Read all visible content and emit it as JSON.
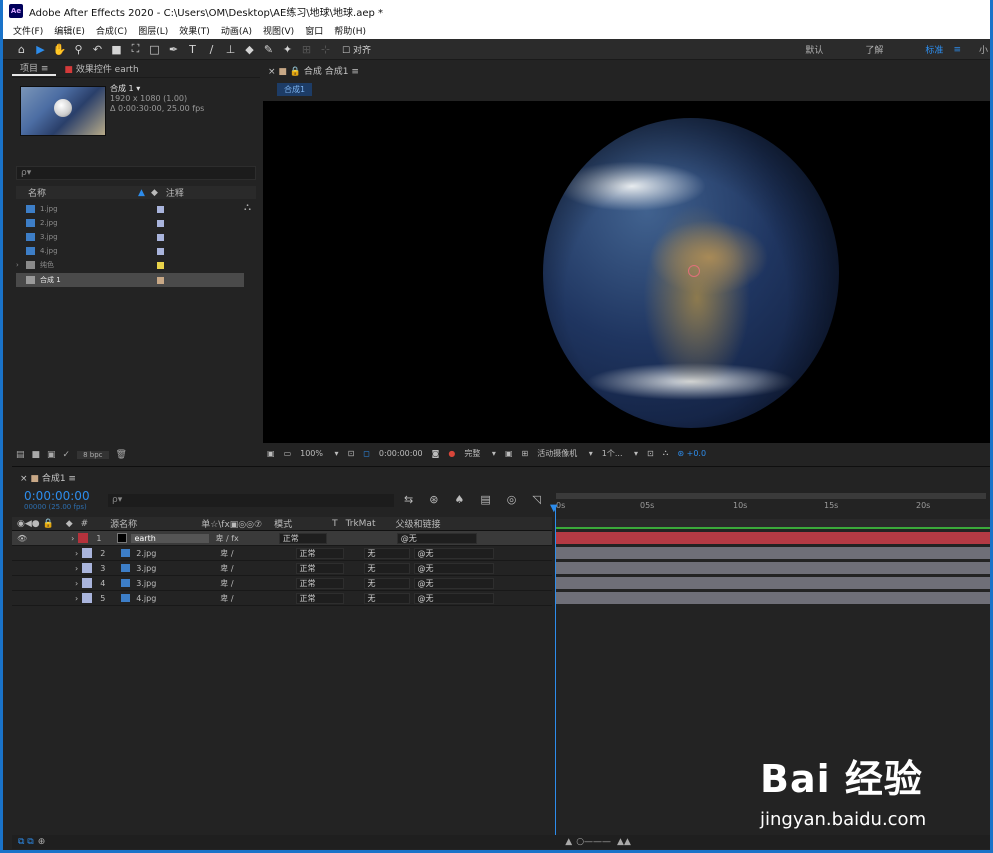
{
  "window": {
    "title": "Adobe After Effects 2020 - C:\\Users\\OM\\Desktop\\AE练习\\地球\\地球.aep *",
    "logo": "Ae"
  },
  "menu": [
    "文件(F)",
    "编辑(E)",
    "合成(C)",
    "图层(L)",
    "效果(T)",
    "动画(A)",
    "视图(V)",
    "窗口",
    "帮助(H)"
  ],
  "toolbar": {
    "tools": [
      "home-icon",
      "selection-icon",
      "hand-icon",
      "zoom-icon",
      "rotate-icon",
      "camera-icon",
      "pan-behind-icon",
      "rectangle-icon",
      "pen-icon",
      "type-icon",
      "brush-icon",
      "clone-stamp-icon",
      "eraser-icon",
      "roto-brush-icon",
      "puppet-pin-icon"
    ],
    "align_label": "对齐",
    "workspaces": [
      "默认",
      "了解",
      "标准",
      "≡",
      "小"
    ]
  },
  "project": {
    "tab_project": "项目",
    "tab_effects": "效果控件 earth",
    "comp_name": "合成 1",
    "comp_info1": "1920 x 1080 (1.00)",
    "comp_info2": "Δ 0:00:30:00, 25.00 fps",
    "search_placeholder": "ρ▾",
    "col_name": "名称",
    "col_notes": "注释",
    "items": [
      {
        "name": "1.jpg",
        "type": "image",
        "label_color": "#a9b4dc"
      },
      {
        "name": "2.jpg",
        "type": "image",
        "label_color": "#a9b4dc"
      },
      {
        "name": "3.jpg",
        "type": "image",
        "label_color": "#a9b4dc"
      },
      {
        "name": "4.jpg",
        "type": "image",
        "label_color": "#a9b4dc"
      },
      {
        "name": "纯色",
        "type": "folder",
        "label_color": "#e8d24a"
      },
      {
        "name": "合成 1",
        "type": "comp",
        "label_color": "#c8a886"
      }
    ],
    "bpc": "8 bpc"
  },
  "viewer": {
    "tab": "合成 合成1",
    "breadcrumb": "合成1",
    "zoom": "100%",
    "timecode": "0:00:00:00",
    "resolution": "完整",
    "camera": "活动摄像机",
    "views": "1个...",
    "exposure": "+0.0"
  },
  "timeline": {
    "tab": "合成1",
    "timecode": "0:00:00:00",
    "frame_info": "00000 (25.00 fps)",
    "search_placeholder": "ρ▾",
    "col_num": "#",
    "col_source": "源名称",
    "col_switches": "单☆\\fx▣◎◎⑦",
    "col_mode": "模式",
    "col_t": "T",
    "col_trkmat": "TrkMat",
    "col_parent": "父级和链接",
    "ruler_ticks": [
      "0s",
      "05s",
      "10s",
      "15s",
      "20s"
    ],
    "layers": [
      {
        "num": "1",
        "name": "earth",
        "color": "#b4323c",
        "mode": "正常",
        "trkmat": "",
        "parent": "无",
        "bar": "red"
      },
      {
        "num": "2",
        "name": "2.jpg",
        "color": "#a9b4dc",
        "mode": "正常",
        "trkmat": "无",
        "parent": "无",
        "bar": "gray"
      },
      {
        "num": "3",
        "name": "3.jpg",
        "color": "#a9b4dc",
        "mode": "正常",
        "trkmat": "无",
        "parent": "无",
        "bar": "gray"
      },
      {
        "num": "4",
        "name": "3.jpg",
        "color": "#a9b4dc",
        "mode": "正常",
        "trkmat": "无",
        "parent": "无",
        "bar": "gray"
      },
      {
        "num": "5",
        "name": "4.jpg",
        "color": "#a9b4dc",
        "mode": "正常",
        "trkmat": "无",
        "parent": "无",
        "bar": "gray"
      }
    ]
  },
  "watermark": {
    "brand": "Bai 经验",
    "url": "jingyan.baidu.com"
  }
}
